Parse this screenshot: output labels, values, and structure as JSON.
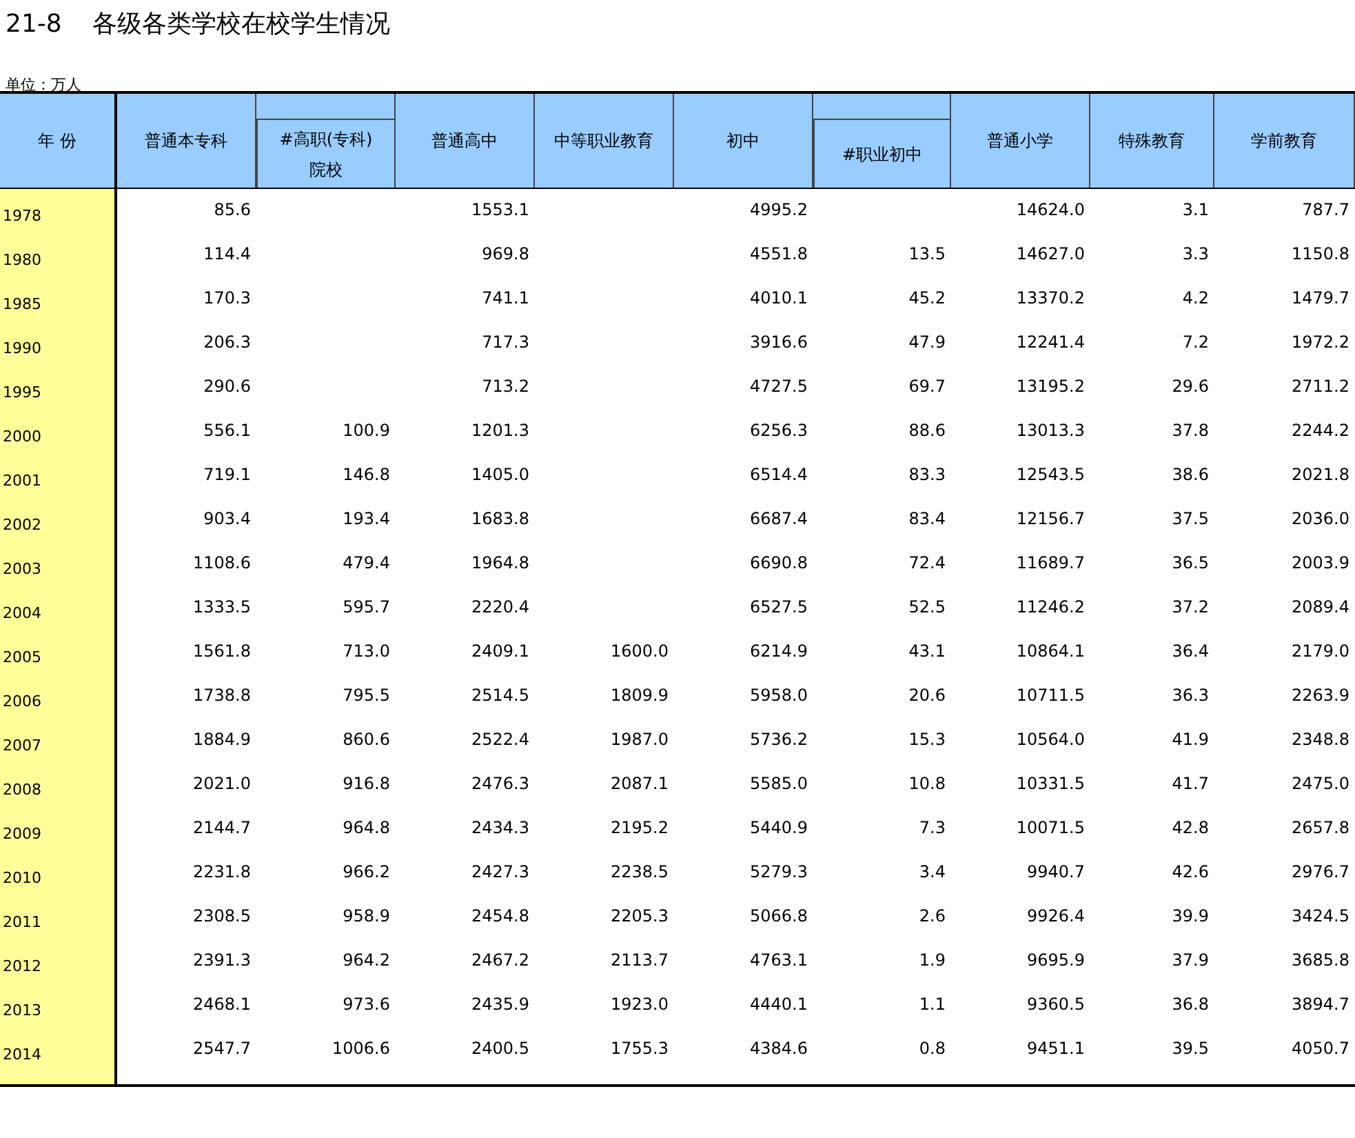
{
  "title": {
    "number": "21-8",
    "text": "各级各类学校在校学生情况"
  },
  "unit": "单位：万人",
  "table": {
    "columns": [
      {
        "label": "年 份",
        "kind": "main"
      },
      {
        "label": "普通本专科",
        "kind": "main"
      },
      {
        "label": "#高职(专科)\n院校",
        "kind": "sub"
      },
      {
        "label": "普通高中",
        "kind": "main"
      },
      {
        "label": "中等职业教育",
        "kind": "main"
      },
      {
        "label": "初中",
        "kind": "main"
      },
      {
        "label": "#职业初中",
        "kind": "sub"
      },
      {
        "label": "普通小学",
        "kind": "main"
      },
      {
        "label": "特殊教育",
        "kind": "main"
      },
      {
        "label": "学前教育",
        "kind": "main"
      }
    ],
    "rows": [
      {
        "year": "1978",
        "undergrad": "85.6",
        "senior_high": "1553.1",
        "junior_high": "4995.2",
        "primary": "14624.0",
        "special": "3.1",
        "preschool": "787.7"
      },
      {
        "year": "1980",
        "undergrad": "114.4",
        "senior_high": "969.8",
        "junior_high": "4551.8",
        "vocational_junior": "13.5",
        "primary": "14627.0",
        "special": "3.3",
        "preschool": "1150.8"
      },
      {
        "year": "1985",
        "undergrad": "170.3",
        "senior_high": "741.1",
        "junior_high": "4010.1",
        "vocational_junior": "45.2",
        "primary": "13370.2",
        "special": "4.2",
        "preschool": "1479.7"
      },
      {
        "year": "1990",
        "undergrad": "206.3",
        "senior_high": "717.3",
        "junior_high": "3916.6",
        "vocational_junior": "47.9",
        "primary": "12241.4",
        "special": "7.2",
        "preschool": "1972.2"
      },
      {
        "year": "1995",
        "undergrad": "290.6",
        "senior_high": "713.2",
        "junior_high": "4727.5",
        "vocational_junior": "69.7",
        "primary": "13195.2",
        "special": "29.6",
        "preschool": "2711.2"
      },
      {
        "year": "2000",
        "undergrad": "556.1",
        "vocational_college": "100.9",
        "senior_high": "1201.3",
        "junior_high": "6256.3",
        "vocational_junior": "88.6",
        "primary": "13013.3",
        "special": "37.8",
        "preschool": "2244.2"
      },
      {
        "year": "2001",
        "undergrad": "719.1",
        "vocational_college": "146.8",
        "senior_high": "1405.0",
        "junior_high": "6514.4",
        "vocational_junior": "83.3",
        "primary": "12543.5",
        "special": "38.6",
        "preschool": "2021.8"
      },
      {
        "year": "2002",
        "undergrad": "903.4",
        "vocational_college": "193.4",
        "senior_high": "1683.8",
        "junior_high": "6687.4",
        "vocational_junior": "83.4",
        "primary": "12156.7",
        "special": "37.5",
        "preschool": "2036.0"
      },
      {
        "year": "2003",
        "undergrad": "1108.6",
        "vocational_college": "479.4",
        "senior_high": "1964.8",
        "junior_high": "6690.8",
        "vocational_junior": "72.4",
        "primary": "11689.7",
        "special": "36.5",
        "preschool": "2003.9"
      },
      {
        "year": "2004",
        "undergrad": "1333.5",
        "vocational_college": "595.7",
        "senior_high": "2220.4",
        "junior_high": "6527.5",
        "vocational_junior": "52.5",
        "primary": "11246.2",
        "special": "37.2",
        "preschool": "2089.4"
      },
      {
        "year": "2005",
        "undergrad": "1561.8",
        "vocational_college": "713.0",
        "senior_high": "2409.1",
        "secondary_vocational": "1600.0",
        "junior_high": "6214.9",
        "vocational_junior": "43.1",
        "primary": "10864.1",
        "special": "36.4",
        "preschool": "2179.0"
      },
      {
        "year": "2006",
        "undergrad": "1738.8",
        "vocational_college": "795.5",
        "senior_high": "2514.5",
        "secondary_vocational": "1809.9",
        "junior_high": "5958.0",
        "vocational_junior": "20.6",
        "primary": "10711.5",
        "special": "36.3",
        "preschool": "2263.9"
      },
      {
        "year": "2007",
        "undergrad": "1884.9",
        "vocational_college": "860.6",
        "senior_high": "2522.4",
        "secondary_vocational": "1987.0",
        "junior_high": "5736.2",
        "vocational_junior": "15.3",
        "primary": "10564.0",
        "special": "41.9",
        "preschool": "2348.8"
      },
      {
        "year": "2008",
        "undergrad": "2021.0",
        "vocational_college": "916.8",
        "senior_high": "2476.3",
        "secondary_vocational": "2087.1",
        "junior_high": "5585.0",
        "vocational_junior": "10.8",
        "primary": "10331.5",
        "special": "41.7",
        "preschool": "2475.0"
      },
      {
        "year": "2009",
        "undergrad": "2144.7",
        "vocational_college": "964.8",
        "senior_high": "2434.3",
        "secondary_vocational": "2195.2",
        "junior_high": "5440.9",
        "vocational_junior": "7.3",
        "primary": "10071.5",
        "special": "42.8",
        "preschool": "2657.8"
      },
      {
        "year": "2010",
        "undergrad": "2231.8",
        "vocational_college": "966.2",
        "senior_high": "2427.3",
        "secondary_vocational": "2238.5",
        "junior_high": "5279.3",
        "vocational_junior": "3.4",
        "primary": "9940.7",
        "special": "42.6",
        "preschool": "2976.7"
      },
      {
        "year": "2011",
        "undergrad": "2308.5",
        "vocational_college": "958.9",
        "senior_high": "2454.8",
        "secondary_vocational": "2205.3",
        "junior_high": "5066.8",
        "vocational_junior": "2.6",
        "primary": "9926.4",
        "special": "39.9",
        "preschool": "3424.5"
      },
      {
        "year": "2012",
        "undergrad": "2391.3",
        "vocational_college": "964.2",
        "senior_high": "2467.2",
        "secondary_vocational": "2113.7",
        "junior_high": "4763.1",
        "vocational_junior": "1.9",
        "primary": "9695.9",
        "special": "37.9",
        "preschool": "3685.8"
      },
      {
        "year": "2013",
        "undergrad": "2468.1",
        "vocational_college": "973.6",
        "senior_high": "2435.9",
        "secondary_vocational": "1923.0",
        "junior_high": "4440.1",
        "vocational_junior": "1.1",
        "primary": "9360.5",
        "special": "36.8",
        "preschool": "3894.7"
      },
      {
        "year": "2014",
        "undergrad": "2547.7",
        "vocational_college": "1006.6",
        "senior_high": "2400.5",
        "secondary_vocational": "1755.3",
        "junior_high": "4384.6",
        "vocational_junior": "0.8",
        "primary": "9451.1",
        "special": "39.5",
        "preschool": "4050.7"
      }
    ]
  }
}
